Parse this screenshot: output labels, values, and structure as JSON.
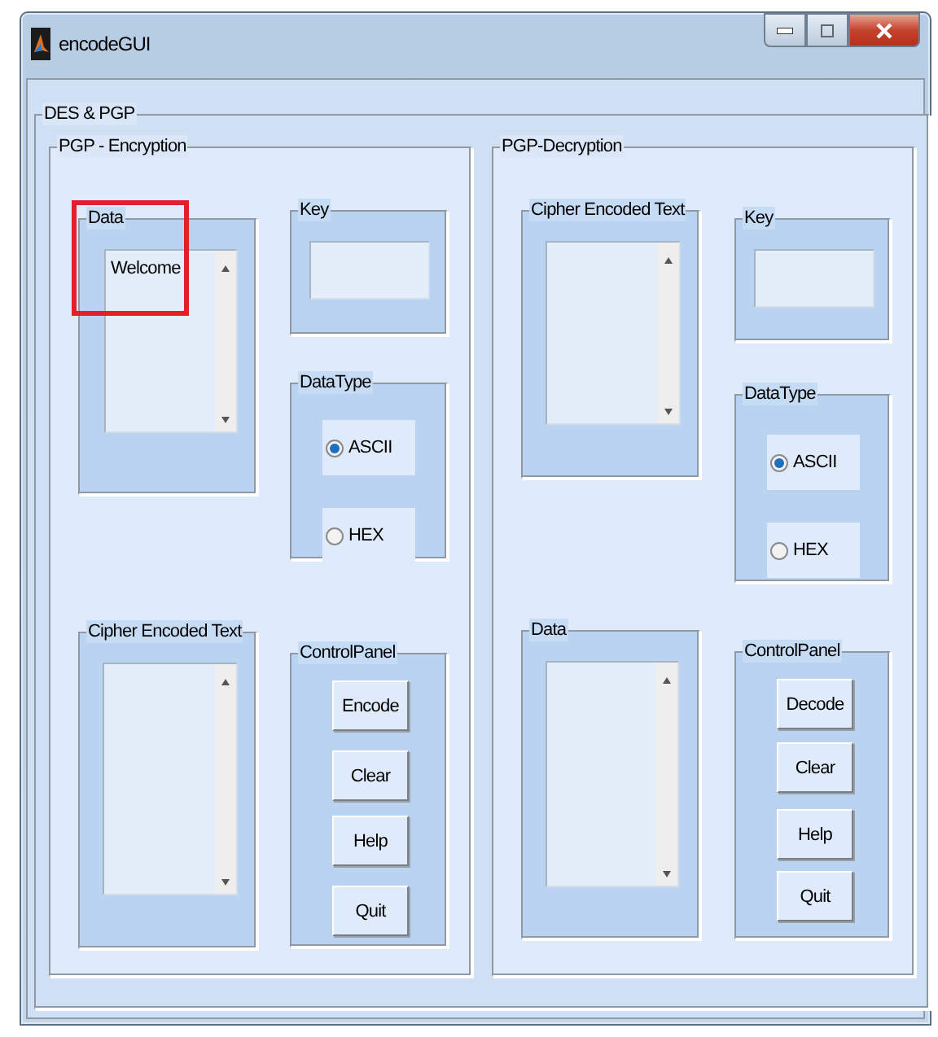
{
  "window": {
    "title": "encodeGUI"
  },
  "main_group": {
    "title": "DES & PGP"
  },
  "panels": [
    {
      "kind": "encryption",
      "title": "PGP - Encryption",
      "columns": [
        [
          {
            "kind": "listbox",
            "title": "Data",
            "text": "Welcome",
            "highlighted": true
          },
          {
            "kind": "listbox",
            "title": "Cipher Encoded Text",
            "text": "",
            "highlighted": false
          }
        ],
        [
          {
            "kind": "field",
            "title": "Key"
          },
          {
            "kind": "radio",
            "title": "DataType",
            "options": [
              {
                "label": "ASCII",
                "selected": true
              },
              {
                "label": "HEX",
                "selected": false
              }
            ]
          },
          {
            "kind": "buttons",
            "title": "ControlPanel",
            "buttons": [
              "Encode",
              "Clear",
              "Help",
              "Quit"
            ]
          }
        ]
      ]
    },
    {
      "kind": "decryption",
      "title": "PGP-Decryption",
      "columns": [
        [
          {
            "kind": "listbox",
            "title": "Cipher Encoded Text",
            "text": "",
            "highlighted": false
          },
          {
            "kind": "listbox",
            "title": "Data",
            "text": "",
            "highlighted": false
          }
        ],
        [
          {
            "kind": "field",
            "title": "Key"
          },
          {
            "kind": "radio",
            "title": "DataType",
            "options": [
              {
                "label": "ASCII",
                "selected": true
              },
              {
                "label": "HEX",
                "selected": false
              }
            ]
          },
          {
            "kind": "buttons",
            "title": "ControlPanel",
            "buttons": [
              "Decode",
              "Clear",
              "Help",
              "Quit"
            ]
          }
        ]
      ]
    }
  ]
}
